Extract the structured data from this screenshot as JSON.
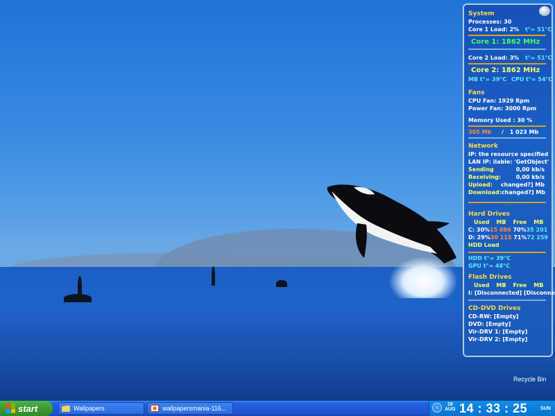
{
  "system": {
    "title": "System",
    "processes": "Processes: 30",
    "core1_load": "Core 1 Load: 2%",
    "core1_temp": "t°= 51°C",
    "core1_freq": "Core 1: 1862 MHz",
    "core2_load": "Core 2 Load: 3%",
    "core2_temp": "t°= 51°C",
    "core2_freq": "Core 2: 1862 MHz",
    "mb_temp": "MB t°= 39°C",
    "cpu_temp": "CPU t°= 54°C"
  },
  "fans": {
    "title": "Fans",
    "cpu_fan": "CPU Fan: 1929 Rpm",
    "power_fan": "Power Fan: 3000 Rpm",
    "memory_used": "Memory Used : 30 %",
    "mem_used_mb": "305 Mb",
    "mem_slash": "/",
    "mem_total_mb": "1 023 Mb"
  },
  "network": {
    "title": "Network",
    "ip": "IP: the resource specified",
    "lan_ip": "LAN IP: ilable: 'GetObject'",
    "sending_label": "Sending",
    "sending_value": "0,00 kb/s",
    "receiving_label": "Receiving:",
    "receiving_value": "0,00 kb/s",
    "upload_label": "Upload:",
    "upload_value": "changed?] Mb",
    "download_label": "Download:",
    "download_value": "changed?] Mb"
  },
  "hard_drives": {
    "title": "Hard Drives",
    "header_used": "Used",
    "header_mb": "MB",
    "header_free": "Free",
    "header_mb2": "MB",
    "drives": [
      {
        "letter": "C:",
        "used_pct": "30%",
        "used_mb": "15 086",
        "free_pct": "70%",
        "free_mb": "35 201"
      },
      {
        "letter": "D:",
        "used_pct": "29%",
        "used_mb": "30 115",
        "free_pct": "71%",
        "free_mb": "72 259"
      }
    ],
    "hdd_load": "HDD Load",
    "hdd_temp": "HDD t°= 39°C",
    "gpu_temp": "GPU t°= 48°C"
  },
  "flash_drives": {
    "title": "Flash Drives",
    "header_used": "Used",
    "header_mb": "MB",
    "header_free": "Free",
    "header_mb2": "MB",
    "row_letter": "I:",
    "row_used": "[Disconnected]",
    "row_free": "[Disconnected]"
  },
  "cd_drives": {
    "title": "CD-DVD Drives",
    "items": [
      "CD-RW: [Empty]",
      "DVD: [Empty]",
      "Vir-DRV 1: [Empty]",
      "Vir-DRV 2: [Empty]"
    ]
  },
  "desktop": {
    "recycle_bin": "Recycle Bin"
  },
  "taskbar": {
    "start_label": "start",
    "tasks": [
      "Wallpapers",
      "wallpapersmania-116..."
    ],
    "clock": {
      "day_num": "19",
      "month": "AUG",
      "time": "14 : 33 : 25",
      "weekday": "SUN"
    }
  },
  "colors": {
    "taskbar": "#245edb",
    "start_green": "#3c9a33",
    "tray": "#0c7fdc",
    "monitor_bg": "#1a5ab9",
    "section_title": "#ffd84a",
    "accent_green": "#49ff5a",
    "accent_cyan": "#5fe8ff"
  }
}
